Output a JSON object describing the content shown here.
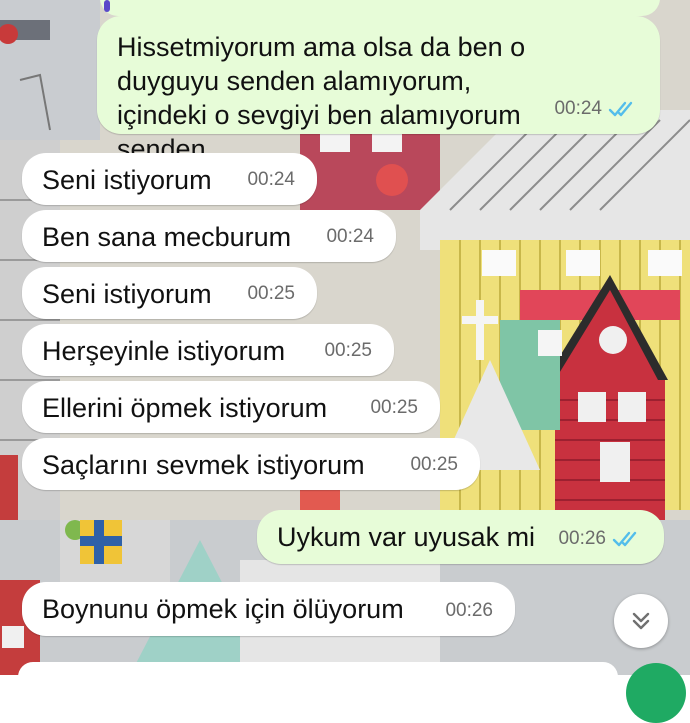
{
  "chat": {
    "messages": [
      {
        "direction": "outgoing",
        "text": "Hissetmiyorum ama olsa da ben o duyguyu senden alamıyorum, içindeki o sevgiyi ben alamıyorum senden",
        "time": "00:24",
        "status": "read"
      },
      {
        "direction": "incoming",
        "text": "Seni istiyorum",
        "time": "00:24"
      },
      {
        "direction": "incoming",
        "text": "Ben sana mecburum",
        "time": "00:24"
      },
      {
        "direction": "incoming",
        "text": "Seni istiyorum",
        "time": "00:25"
      },
      {
        "direction": "incoming",
        "text": "Herşeyinle istiyorum",
        "time": "00:25"
      },
      {
        "direction": "incoming",
        "text": "Ellerini öpmek istiyorum",
        "time": "00:25"
      },
      {
        "direction": "incoming",
        "text": "Saçlarını sevmek istiyorum",
        "time": "00:25"
      },
      {
        "direction": "outgoing",
        "text": "Uykum var uyusak mi",
        "time": "00:26",
        "status": "read"
      },
      {
        "direction": "incoming",
        "text": "Boynunu öpmek için ölüyorum",
        "time": "00:26"
      }
    ]
  },
  "colors": {
    "outgoing_bubble": "#e7fcd8",
    "incoming_bubble": "#ffffff",
    "read_tick": "#53bdeb",
    "send_button": "#1faa63"
  },
  "icons": {
    "scroll_down": "chevrons-down-icon",
    "read_receipt": "double-check-icon"
  }
}
